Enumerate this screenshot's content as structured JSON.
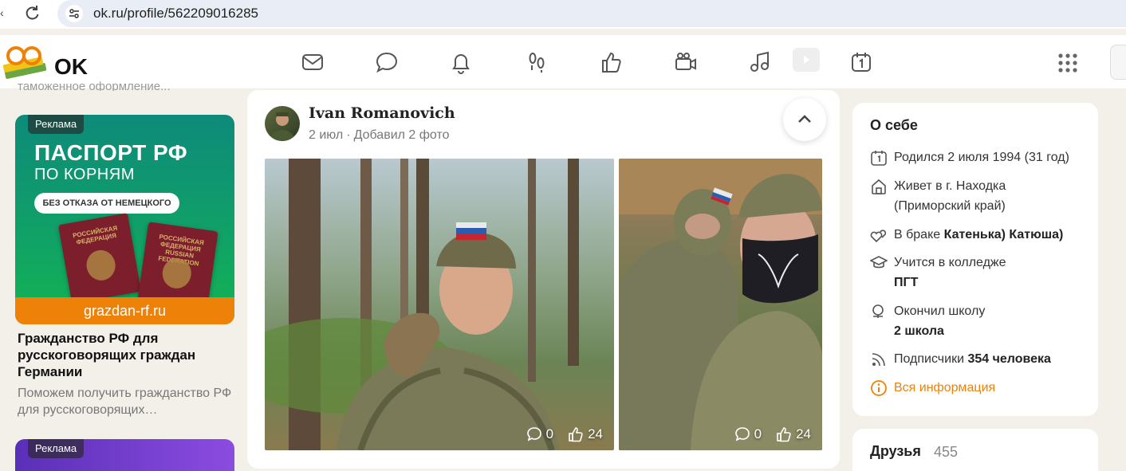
{
  "browser": {
    "url": "ok.ru/profile/562209016285"
  },
  "header": {
    "brand": "OK",
    "nav_icons": [
      "mail-icon",
      "chat-icon",
      "bell-icon",
      "footprints-icon",
      "like-icon",
      "camera-icon",
      "music-icon",
      "video-icon",
      "calendar-icon"
    ]
  },
  "left": {
    "faded_text": "таможенное оформление...",
    "ad1": {
      "badge": "Реклама",
      "headline1": "ПАСПОРТ РФ",
      "headline2": "ПО КОРНЯМ",
      "pill": "БЕЗ ОТКАЗА ОТ НЕМЕЦКОГО",
      "passport_text_ru": "РОССИЙСКАЯ ФЕДЕРАЦИЯ",
      "passport_text_en": "РОССИЙСКАЯ ФЕДЕРАЦИЯ RUSSIAN FEDERATION",
      "domain": "grazdan-rf.ru",
      "title": "Гражданство РФ для русскоговорящих граждан Германии",
      "description": "Поможем получить гражданство РФ для русскоговорящих…"
    },
    "ad2": {
      "badge": "Реклама"
    }
  },
  "post": {
    "author": "Ivan Romanovich",
    "date": "2 июл",
    "action": "Добавил 2 фото",
    "photos": [
      {
        "comments": "0",
        "likes": "24"
      },
      {
        "comments": "0",
        "likes": "24"
      }
    ]
  },
  "about": {
    "title": "О себе",
    "born": "Родился 2 июля 1994 (31 год)",
    "lives_prefix": "Живет в г. Находка",
    "lives_region": "(Приморский край)",
    "married_prefix": "В браке ",
    "married_name": "Катенька) Катюша)",
    "studies_prefix": "Учится в колледже",
    "studies_name": "ПГТ",
    "school_prefix": "Окончил школу",
    "school_name": "2 школа",
    "followers_prefix": "Подписчики ",
    "followers_count": "354 человека",
    "all_info": "Вся информация"
  },
  "friends": {
    "title": "Друзья",
    "count": "455"
  }
}
